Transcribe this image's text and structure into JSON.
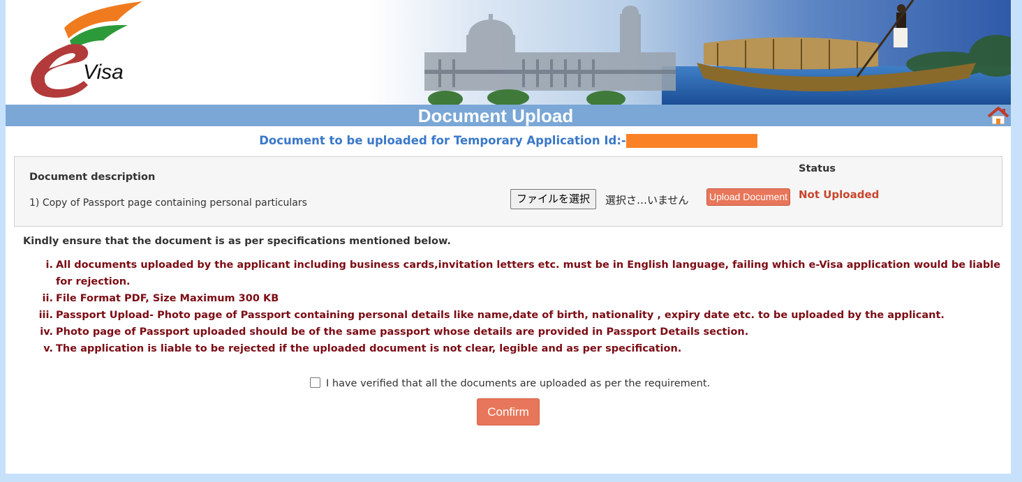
{
  "banner": {
    "logo_text": "Visa"
  },
  "header": {
    "title": "Document Upload",
    "home_icon": "home-icon"
  },
  "subtitle": {
    "text": "Document to be uploaded for Temporary Application Id:-"
  },
  "documents": {
    "description_header": "Document description",
    "status_header": "Status",
    "item_label": "1) Copy of Passport page containing personal particulars",
    "file_button_label": "ファイルを選択",
    "file_status_text": "選択さ…いません",
    "upload_button_label": "Upload Document",
    "status_value": "Not Uploaded"
  },
  "specs": {
    "intro": "Kindly ensure that the document is as per specifications mentioned below.",
    "items": [
      {
        "num": "i.",
        "text": "All documents uploaded by the applicant including business cards,invitation letters etc. must be in English language, failing which e-Visa application would be liable for rejection."
      },
      {
        "num": "ii.",
        "text": "File Format PDF, Size Maximum 300 KB"
      },
      {
        "num": "iii.",
        "text": "Passport Upload- Photo page of Passport containing personal details like name,date of birth, nationality , expiry date etc. to be uploaded by the applicant."
      },
      {
        "num": "iv.",
        "text": "Photo page of Passport uploaded should be of the same passport whose details are provided in Passport Details section."
      },
      {
        "num": "v.",
        "text": "The application is liable to be rejected if the uploaded document is not clear, legible and as per specification."
      }
    ]
  },
  "verification": {
    "checkbox_label": "I have verified that all the documents are uploaded as per the requirement.",
    "checked": false
  },
  "confirm_label": "Confirm",
  "colors": {
    "page_bg": "#c8e1fb",
    "title_bar": "#7aa7d6",
    "subtitle": "#3a78c9",
    "spec_text": "#7b0c14",
    "status_text": "#c8452c",
    "button": "#e8765a",
    "redaction": "#fb8127"
  }
}
